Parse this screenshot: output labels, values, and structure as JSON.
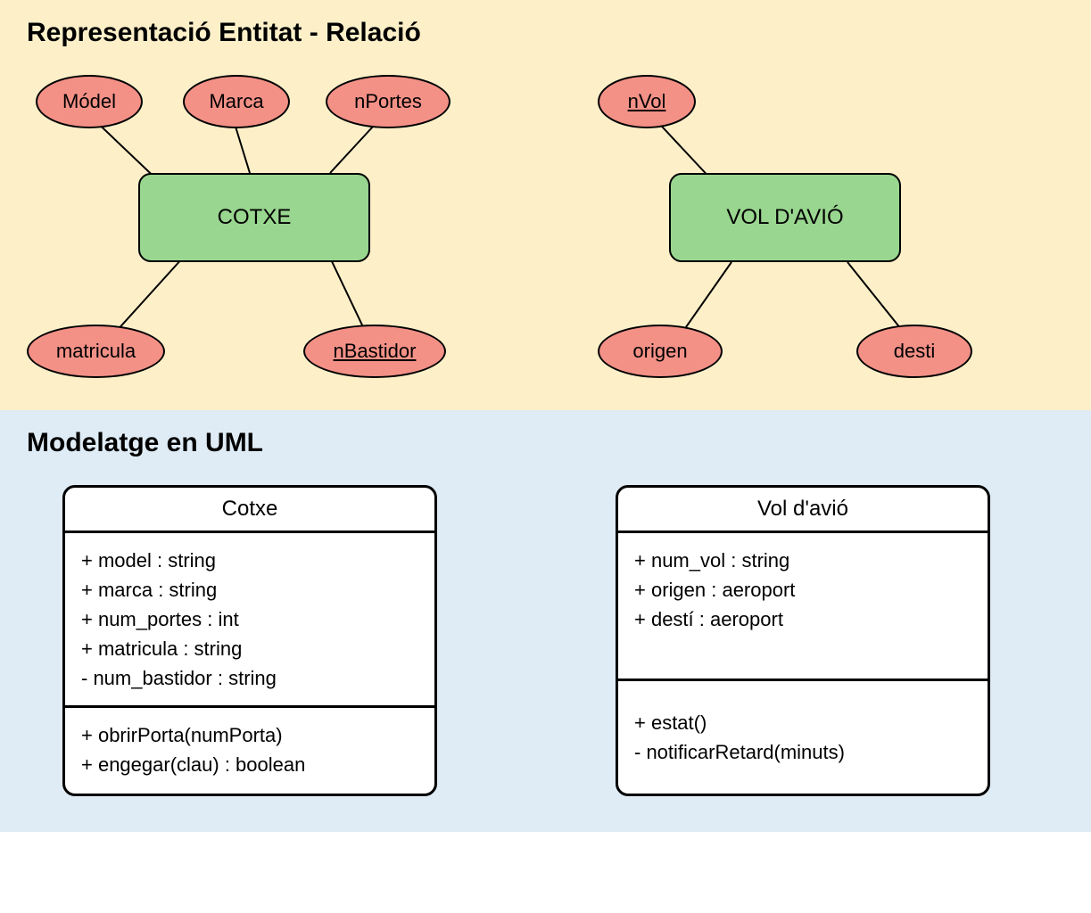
{
  "er": {
    "title": "Representació Entitat - Relació",
    "entities": {
      "cotxe": "COTXE",
      "vol": "VOL D'AVIÓ"
    },
    "attrs": {
      "model": "Módel",
      "marca": "Marca",
      "nportes": "nPortes",
      "matricula": "matricula",
      "nbastidor": "nBastidor",
      "nvol": "nVol",
      "origen": "origen",
      "desti": "desti"
    }
  },
  "uml": {
    "title": "Modelatge en UML",
    "classes": {
      "cotxe": {
        "name": "Cotxe",
        "attrs": [
          "+ model : string",
          "+ marca : string",
          "+ num_portes : int",
          "+ matricula : string",
          "- num_bastidor : string"
        ],
        "methods": [
          "+ obrirPorta(numPorta)",
          "+ engegar(clau) : boolean"
        ]
      },
      "vol": {
        "name": "Vol d'avió",
        "attrs": [
          "+ num_vol : string",
          "+ origen : aeroport",
          "+ destí : aeroport"
        ],
        "methods": [
          "+ estat()",
          "- notificarRetard(minuts)"
        ]
      }
    }
  }
}
